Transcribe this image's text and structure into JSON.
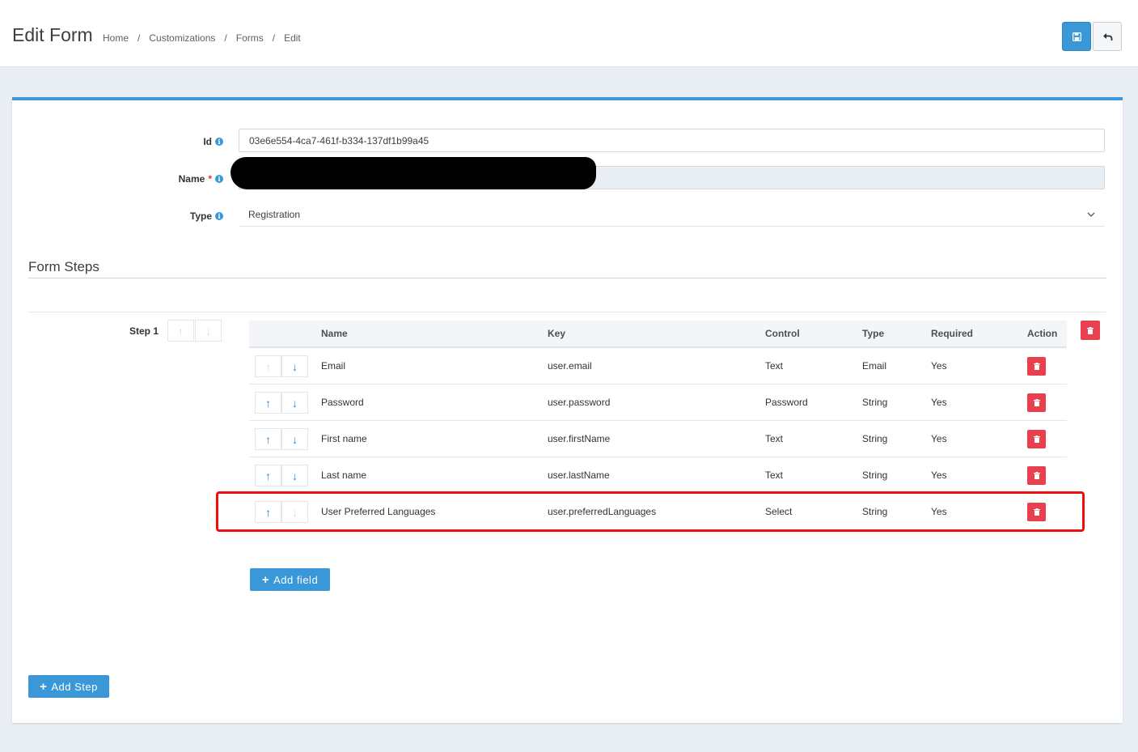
{
  "header": {
    "title": "Edit Form",
    "breadcrumb": [
      "Home",
      "Customizations",
      "Forms",
      "Edit"
    ],
    "separator": "/"
  },
  "form": {
    "id_label": "Id",
    "id_value": "03e6e554-4ca7-461f-b334-137df1b99a45",
    "name_label": "Name",
    "name_required_mark": "*",
    "name_value": "",
    "type_label": "Type",
    "type_value": "Registration",
    "info_glyph": "i"
  },
  "steps_section": {
    "title": "Form Steps",
    "add_step_label": "Add Step",
    "steps": [
      {
        "label": "Step 1",
        "columns": [
          "Name",
          "Key",
          "Control",
          "Type",
          "Required",
          "Action"
        ],
        "rows": [
          {
            "name": "Email",
            "key": "user.email",
            "control": "Text",
            "type": "Email",
            "required": "Yes",
            "up_enabled": false,
            "down_enabled": true
          },
          {
            "name": "Password",
            "key": "user.password",
            "control": "Password",
            "type": "String",
            "required": "Yes",
            "up_enabled": true,
            "down_enabled": true
          },
          {
            "name": "First name",
            "key": "user.firstName",
            "control": "Text",
            "type": "String",
            "required": "Yes",
            "up_enabled": true,
            "down_enabled": true
          },
          {
            "name": "Last name",
            "key": "user.lastName",
            "control": "Text",
            "type": "String",
            "required": "Yes",
            "up_enabled": true,
            "down_enabled": true
          },
          {
            "name": "User Preferred Languages",
            "key": "user.preferredLanguages",
            "control": "Select",
            "type": "String",
            "required": "Yes",
            "up_enabled": true,
            "down_enabled": false
          }
        ],
        "add_field_label": "Add field"
      }
    ]
  },
  "icons": {
    "up": "↑",
    "down": "↓",
    "plus": "+"
  },
  "colors": {
    "primary": "#3a98d9",
    "danger": "#e8404e",
    "highlight": "#f10d0d"
  }
}
